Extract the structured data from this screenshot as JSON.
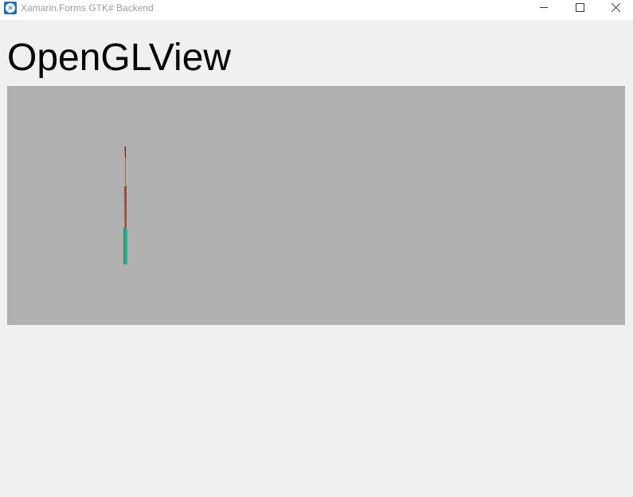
{
  "window": {
    "title": "Xamarin.Forms GTK# Backend",
    "app_icon": "xamarin-logo-icon",
    "controls": {
      "minimize_icon": "minimize-icon",
      "maximize_icon": "maximize-icon",
      "close_icon": "close-icon"
    }
  },
  "page": {
    "heading": "OpenGLView"
  },
  "opengl_view": {
    "background": "#b0b0b0",
    "render_colors": [
      "#7a1a1a",
      "#b4672e",
      "#9a4a3a",
      "#8a6a3a",
      "#2f9a6a",
      "#1fb6b0"
    ]
  }
}
